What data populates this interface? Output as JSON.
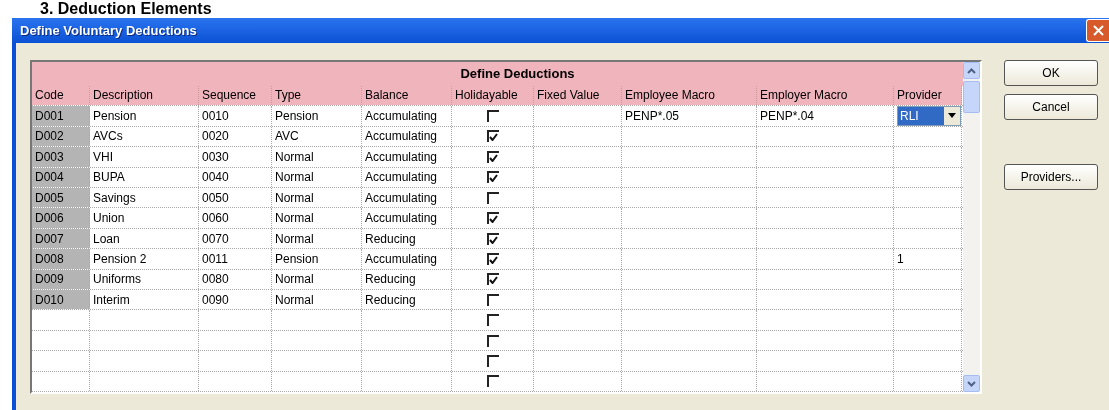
{
  "page_heading": "3. Deduction Elements",
  "window": {
    "title": "Define Voluntary Deductions"
  },
  "grid": {
    "title": "Define Deductions",
    "columns": [
      "Code",
      "Description",
      "Sequence",
      "Type",
      "Balance",
      "Holidayable",
      "Fixed Value",
      "Employee Macro",
      "Employer Macro",
      "Provider"
    ],
    "rows": [
      {
        "code": "D001",
        "description": "Pension",
        "sequence": "0010",
        "type": "Pension",
        "balance": "Accumulating",
        "holidayable": false,
        "employee_macro": "PENP*.05",
        "employer_macro": "PENP*.04",
        "provider": {
          "kind": "dropdown",
          "value": "RLI"
        }
      },
      {
        "code": "D002",
        "description": "AVCs",
        "sequence": "0020",
        "type": "AVC",
        "balance": "Accumulating",
        "holidayable": true
      },
      {
        "code": "D003",
        "description": "VHI",
        "sequence": "0030",
        "type": "Normal",
        "balance": "Accumulating",
        "holidayable": true
      },
      {
        "code": "D004",
        "description": "BUPA",
        "sequence": "0040",
        "type": "Normal",
        "balance": "Accumulating",
        "holidayable": true
      },
      {
        "code": "D005",
        "description": "Savings",
        "sequence": "0050",
        "type": "Normal",
        "balance": "Accumulating",
        "holidayable": false
      },
      {
        "code": "D006",
        "description": "Union",
        "sequence": "0060",
        "type": "Normal",
        "balance": "Accumulating",
        "holidayable": true
      },
      {
        "code": "D007",
        "description": "Loan",
        "sequence": "0070",
        "type": "Normal",
        "balance": "Reducing",
        "holidayable": true
      },
      {
        "code": "D008",
        "description": "Pension 2",
        "sequence": "0011",
        "type": "Pension",
        "balance": "Accumulating",
        "holidayable": true,
        "provider": {
          "kind": "text",
          "value": "1"
        }
      },
      {
        "code": "D009",
        "description": "Uniforms",
        "sequence": "0080",
        "type": "Normal",
        "balance": "Reducing",
        "holidayable": true
      },
      {
        "code": "D010",
        "description": "Interim",
        "sequence": "0090",
        "type": "Normal",
        "balance": "Reducing",
        "holidayable": false
      },
      {
        "holidayable": false
      },
      {
        "holidayable": false
      },
      {
        "holidayable": false
      },
      {
        "holidayable": false
      }
    ]
  },
  "buttons": [
    "OK",
    "Cancel",
    "Providers..."
  ]
}
